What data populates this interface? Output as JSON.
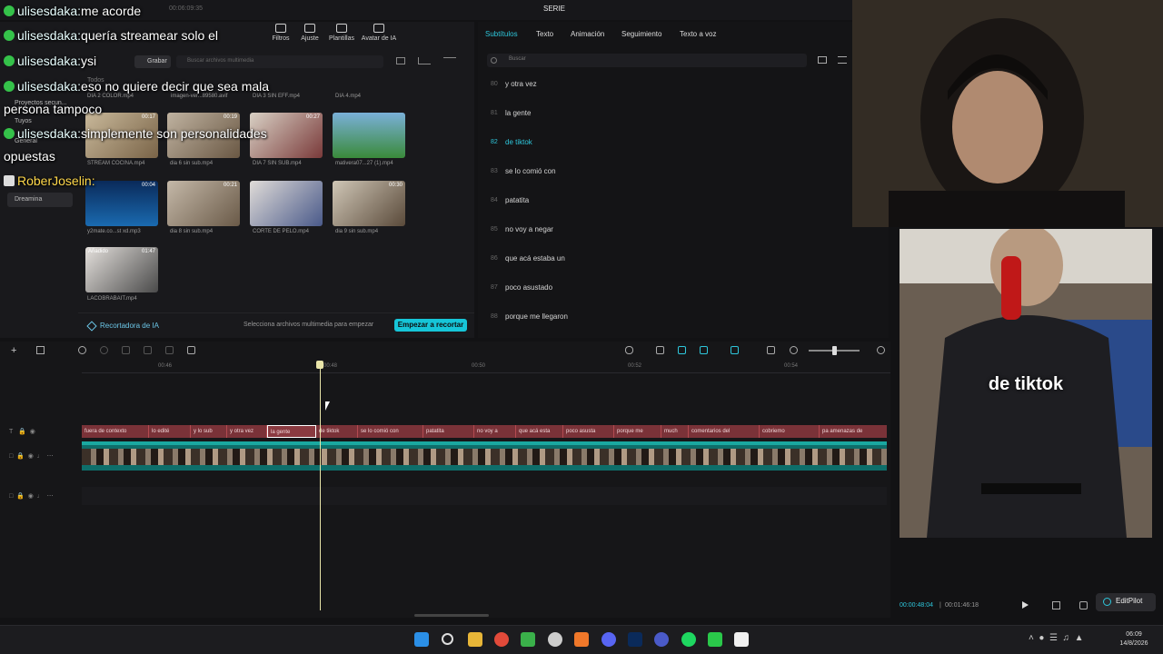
{
  "app": {
    "title": "SERIE",
    "time": "00:06:09:35"
  },
  "toolbar": {
    "items": [
      "Filtros",
      "Ajuste",
      "Plantillas",
      "Avatar de IA"
    ]
  },
  "leftnav": {
    "items": [
      "Todos",
      "Proyectos secun...",
      "Tuyos",
      "General",
      "Dreamina"
    ]
  },
  "media": {
    "record_label": "Grabar",
    "search_placeholder": "Buscar archivos multimedia",
    "top_row": [
      "DIA 2 COLOR.mp4",
      "imagen-ver...89580.avif",
      "DIA 3 SIN EFF.mp4",
      "DIA 4.mp4"
    ],
    "thumbs": [
      {
        "name": "STREAM COCINA.mp4",
        "dur": "00:17"
      },
      {
        "name": "dia 6 sin sub.mp4",
        "dur": "00:19"
      },
      {
        "name": "DIA 7 SIN SUB.mp4",
        "dur": "00:27"
      },
      {
        "name": "mativera07...27 (1).mp4",
        "dur": ""
      },
      {
        "name": "y2mate.co...st xd.mp3",
        "dur": "00:04"
      },
      {
        "name": "dia 8 sin sub.mp4",
        "dur": "00:21"
      },
      {
        "name": "CORTE DE PELO.mp4",
        "dur": ""
      },
      {
        "name": "dia 9 sin sub.mp4",
        "dur": "00:30"
      },
      {
        "name": "LACOBRABAIT.mp4",
        "dur": "01:47",
        "badge": "Añadido"
      }
    ],
    "footer": {
      "ai_cutter": "Recortadora de IA",
      "hint": "Selecciona archivos multimedia para empezar",
      "start": "Empezar a recortar"
    }
  },
  "subtitles_panel": {
    "tabs": [
      "Subtítulos",
      "Texto",
      "Animación",
      "Seguimiento",
      "Texto a voz"
    ],
    "search_placeholder": "Buscar",
    "rows": [
      {
        "n": "80",
        "text": "y otra vez"
      },
      {
        "n": "81",
        "text": "la gente"
      },
      {
        "n": "82",
        "text": "de tiktok",
        "active": true
      },
      {
        "n": "83",
        "text": "se lo comió con"
      },
      {
        "n": "84",
        "text": "patatita"
      },
      {
        "n": "85",
        "text": "no voy a negar"
      },
      {
        "n": "86",
        "text": "que acá estaba un"
      },
      {
        "n": "87",
        "text": "poco asustado"
      },
      {
        "n": "88",
        "text": "porque me llegaron"
      }
    ]
  },
  "chat": [
    {
      "user": "ulisesdaka:",
      "msg": "me acorde"
    },
    {
      "user": "ulisesdaka:",
      "msg": "quería streamear solo el"
    },
    {
      "user": "ulisesdaka:",
      "msg": "ysi"
    },
    {
      "user": "ulisesdaka:",
      "msg": "eso no quiere decir que sea mala"
    },
    {
      "user": "",
      "msg": "persona tampoco"
    },
    {
      "user": "ulisesdaka:",
      "msg": "simplemente son personalidades"
    },
    {
      "user": "",
      "msg": "opuestas"
    },
    {
      "user": "RoberJoselin:",
      "msg": ""
    }
  ],
  "preview": {
    "caption": "de tiktok",
    "current": "00:00:48:04",
    "total": "00:01:46:18",
    "editpilot": "EditPilot"
  },
  "timeline": {
    "ruler": [
      "00:46",
      "00:48",
      "00:50",
      "00:52",
      "00:54"
    ],
    "clips": [
      "fuera de contexto",
      "lo edité",
      "y lo sub",
      "y otra vez",
      "la gente",
      "de tiktok",
      "se lo comió con",
      "patatita",
      "no voy a",
      "que acá esta",
      "poco asusta",
      "porque me",
      "much",
      "comentarios del",
      "cobriemo",
      "pa amenazas de"
    ]
  },
  "taskbar": {
    "time": "06:09",
    "date": "14/8/2026"
  },
  "colors": {
    "accent": "#2ec7dc",
    "subtitle_track": "#7a3238",
    "video_track": "#0e6e6a"
  }
}
